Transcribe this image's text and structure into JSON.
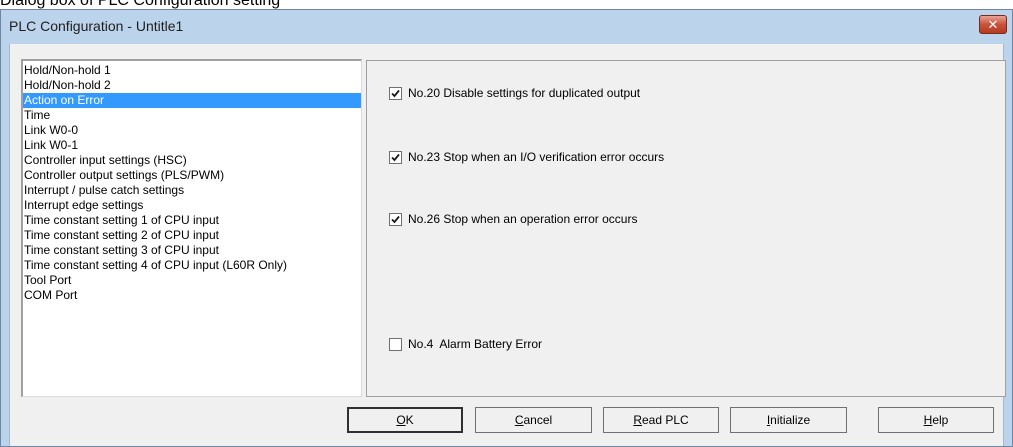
{
  "caption": "Dialog box of PLC Configuration setting",
  "window": {
    "title": "PLC Configuration - Untitle1",
    "close_glyph": "✕"
  },
  "list": {
    "items": [
      {
        "label": "Hold/Non-hold 1",
        "selected": false
      },
      {
        "label": "Hold/Non-hold 2",
        "selected": false
      },
      {
        "label": "Action on Error",
        "selected": true
      },
      {
        "label": "Time",
        "selected": false
      },
      {
        "label": "Link W0-0",
        "selected": false
      },
      {
        "label": "Link W0-1",
        "selected": false
      },
      {
        "label": "Controller input settings (HSC)",
        "selected": false
      },
      {
        "label": "Controller output settings (PLS/PWM)",
        "selected": false
      },
      {
        "label": "Interrupt / pulse catch settings",
        "selected": false
      },
      {
        "label": "Interrupt edge settings",
        "selected": false
      },
      {
        "label": "Time constant setting 1 of CPU input",
        "selected": false
      },
      {
        "label": "Time constant setting 2 of CPU input",
        "selected": false
      },
      {
        "label": "Time constant setting 3 of CPU input",
        "selected": false
      },
      {
        "label": "Time constant setting 4 of CPU input (L60R Only)",
        "selected": false
      },
      {
        "label": "Tool Port",
        "selected": false
      },
      {
        "label": "COM Port",
        "selected": false
      }
    ]
  },
  "options": {
    "dup_output": {
      "label": "No.20 Disable settings for duplicated output",
      "checked": true
    },
    "io_verify": {
      "label": "No.23 Stop when an I/O verification error occurs",
      "checked": true
    },
    "op_error": {
      "label": "No.26 Stop when an operation error occurs",
      "checked": true
    },
    "battery": {
      "label": "No.4  Alarm Battery Error",
      "checked": false
    }
  },
  "buttons": {
    "ok": {
      "mn": "O",
      "rest": "K"
    },
    "cancel": {
      "mn": "C",
      "rest": "ancel"
    },
    "read": {
      "mn": "R",
      "rest": "ead PLC"
    },
    "initialize": {
      "mn": "I",
      "rest": "nitialize"
    },
    "help": {
      "mn": "H",
      "rest": "elp"
    }
  },
  "colors": {
    "selection": "#3399ff",
    "titlebar": "#bcd3ec",
    "close": "#c8523a"
  }
}
